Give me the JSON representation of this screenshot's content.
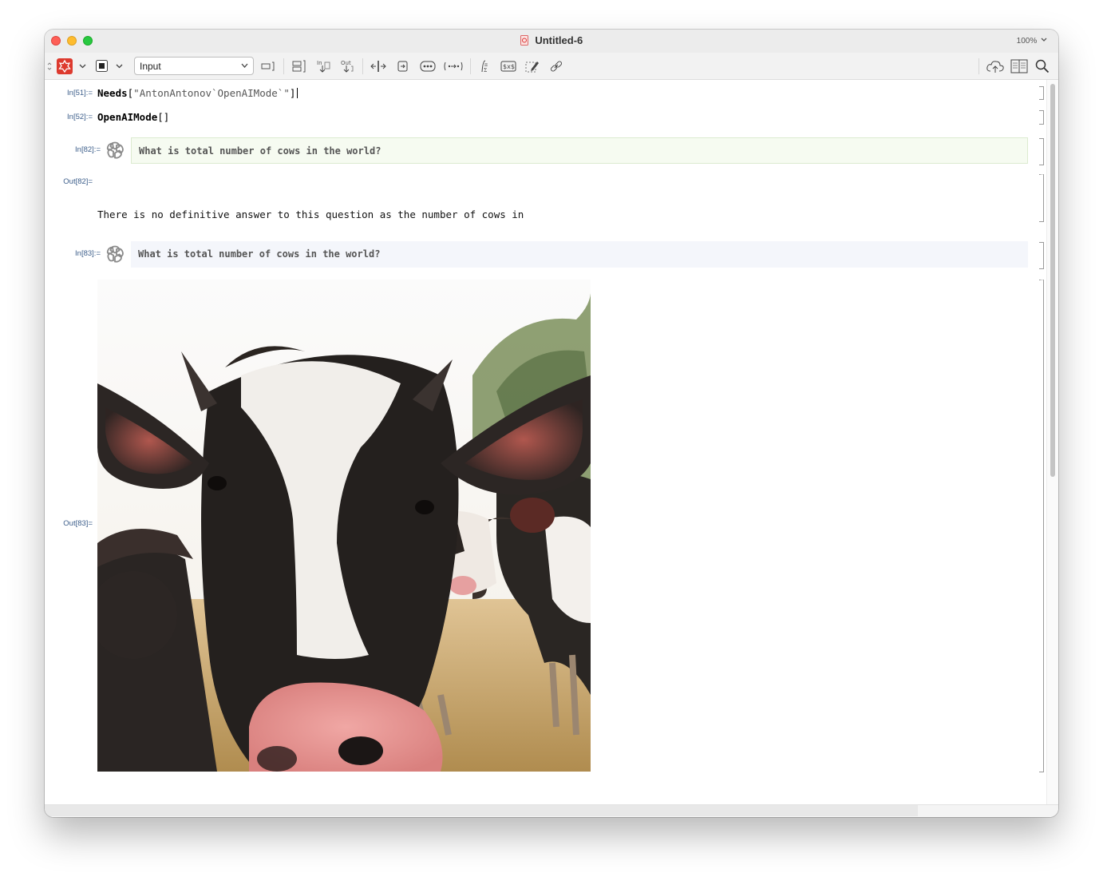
{
  "window": {
    "title": "Untitled-6",
    "zoom": "100%"
  },
  "toolbar": {
    "style_select": "Input"
  },
  "cells": {
    "c1": {
      "label": "In[51]:=",
      "code_fn": "Needs",
      "code_open": "[",
      "code_str": "\"AntonAntonov`OpenAIMode`\"",
      "code_close": "]"
    },
    "c2": {
      "label": "In[52]:=",
      "code_fn": "OpenAIMode",
      "code_args": "[]"
    },
    "c3": {
      "label": "In[82]:=",
      "prompt": "What is total number of cows in the world?"
    },
    "c3out": {
      "label": "Out[82]=",
      "text": "There is no definitive answer to this question as the number of cows in"
    },
    "c4": {
      "label": "In[83]:=",
      "prompt": "What is total number of cows in the world?"
    },
    "c4out": {
      "label": "Out[83]=",
      "image": "close-up photo of a black and white cow with a herd of cows behind it"
    }
  },
  "colors": {
    "close": "#fe5f57",
    "minimize": "#febc2e",
    "maximize": "#28c840",
    "cell_label": "#3b5d8a",
    "green_prompt_bg": "#f6fbf1",
    "blue_prompt_bg": "#f4f6fb"
  }
}
